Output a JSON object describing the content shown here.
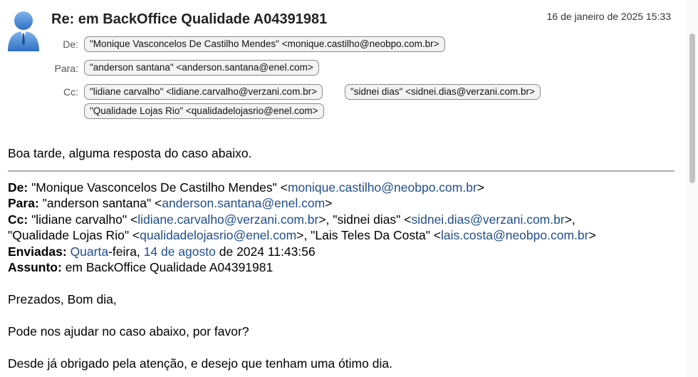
{
  "email": {
    "subject": "Re: em BackOffice Qualidade A04391981",
    "date": "16 de janeiro de 2025 15:33",
    "labels": {
      "from": "De:",
      "to": "Para:",
      "cc": "Cc:"
    },
    "from": "\"Monique Vasconcelos De Castilho Mendes\" <monique.castilho@neobpo.com.br>",
    "to": [
      "\"anderson santana\" <anderson.santana@enel.com>"
    ],
    "cc": [
      "\"lidiane carvalho\" <lidiane.carvalho@verzani.com.br>",
      "\"sidnei dias\" <sidnei.dias@verzani.com.br>",
      "\"Qualidade Lojas Rio\" <qualidadelojasrio@enel.com>"
    ]
  },
  "body": {
    "greeting": "Boa tarde, alguma resposta do caso abaixo.",
    "quoted": {
      "from_label": "De:",
      "from_name": " \"Monique Vasconcelos De Castilho Mendes\" <",
      "from_email": "monique.castilho@neobpo.com.br",
      "from_end": ">",
      "to_label": "Para:",
      "to_name": " \"anderson santana\" <",
      "to_email": "anderson.santana@enel.com",
      "to_end": ">",
      "cc_label": "Cc:",
      "cc1_name": " \"lidiane carvalho\" <",
      "cc1_email": "lidiane.carvalho@verzani.com.br",
      "cc2_name": ">, \"sidnei dias\" <",
      "cc2_email": "sidnei.dias@verzani.com.br",
      "cc2_end": ">,",
      "cc3_name": "\"Qualidade Lojas Rio\" <",
      "cc3_email": "qualidadelojasrio@enel.com",
      "cc4_name": ">, \"Lais Teles Da Costa\" <",
      "cc4_email": "lais.costa@neobpo.com.br",
      "cc4_end": ">",
      "sent_label": "Enviadas:",
      "sent_weekday": "Quarta",
      "sent_feira": "-feira, ",
      "sent_date": "14 de agosto",
      "sent_rest": " de 2024 11:43:56",
      "subject_label": "Assunto:",
      "subject_value": " em BackOffice Qualidade A04391981"
    },
    "line1": "Prezados, Bom dia,",
    "line2": "Pode nos ajudar no caso abaixo, por favor?",
    "line3": "Desde já obrigado pela atenção, e desejo que tenham uma ótimo dia."
  }
}
